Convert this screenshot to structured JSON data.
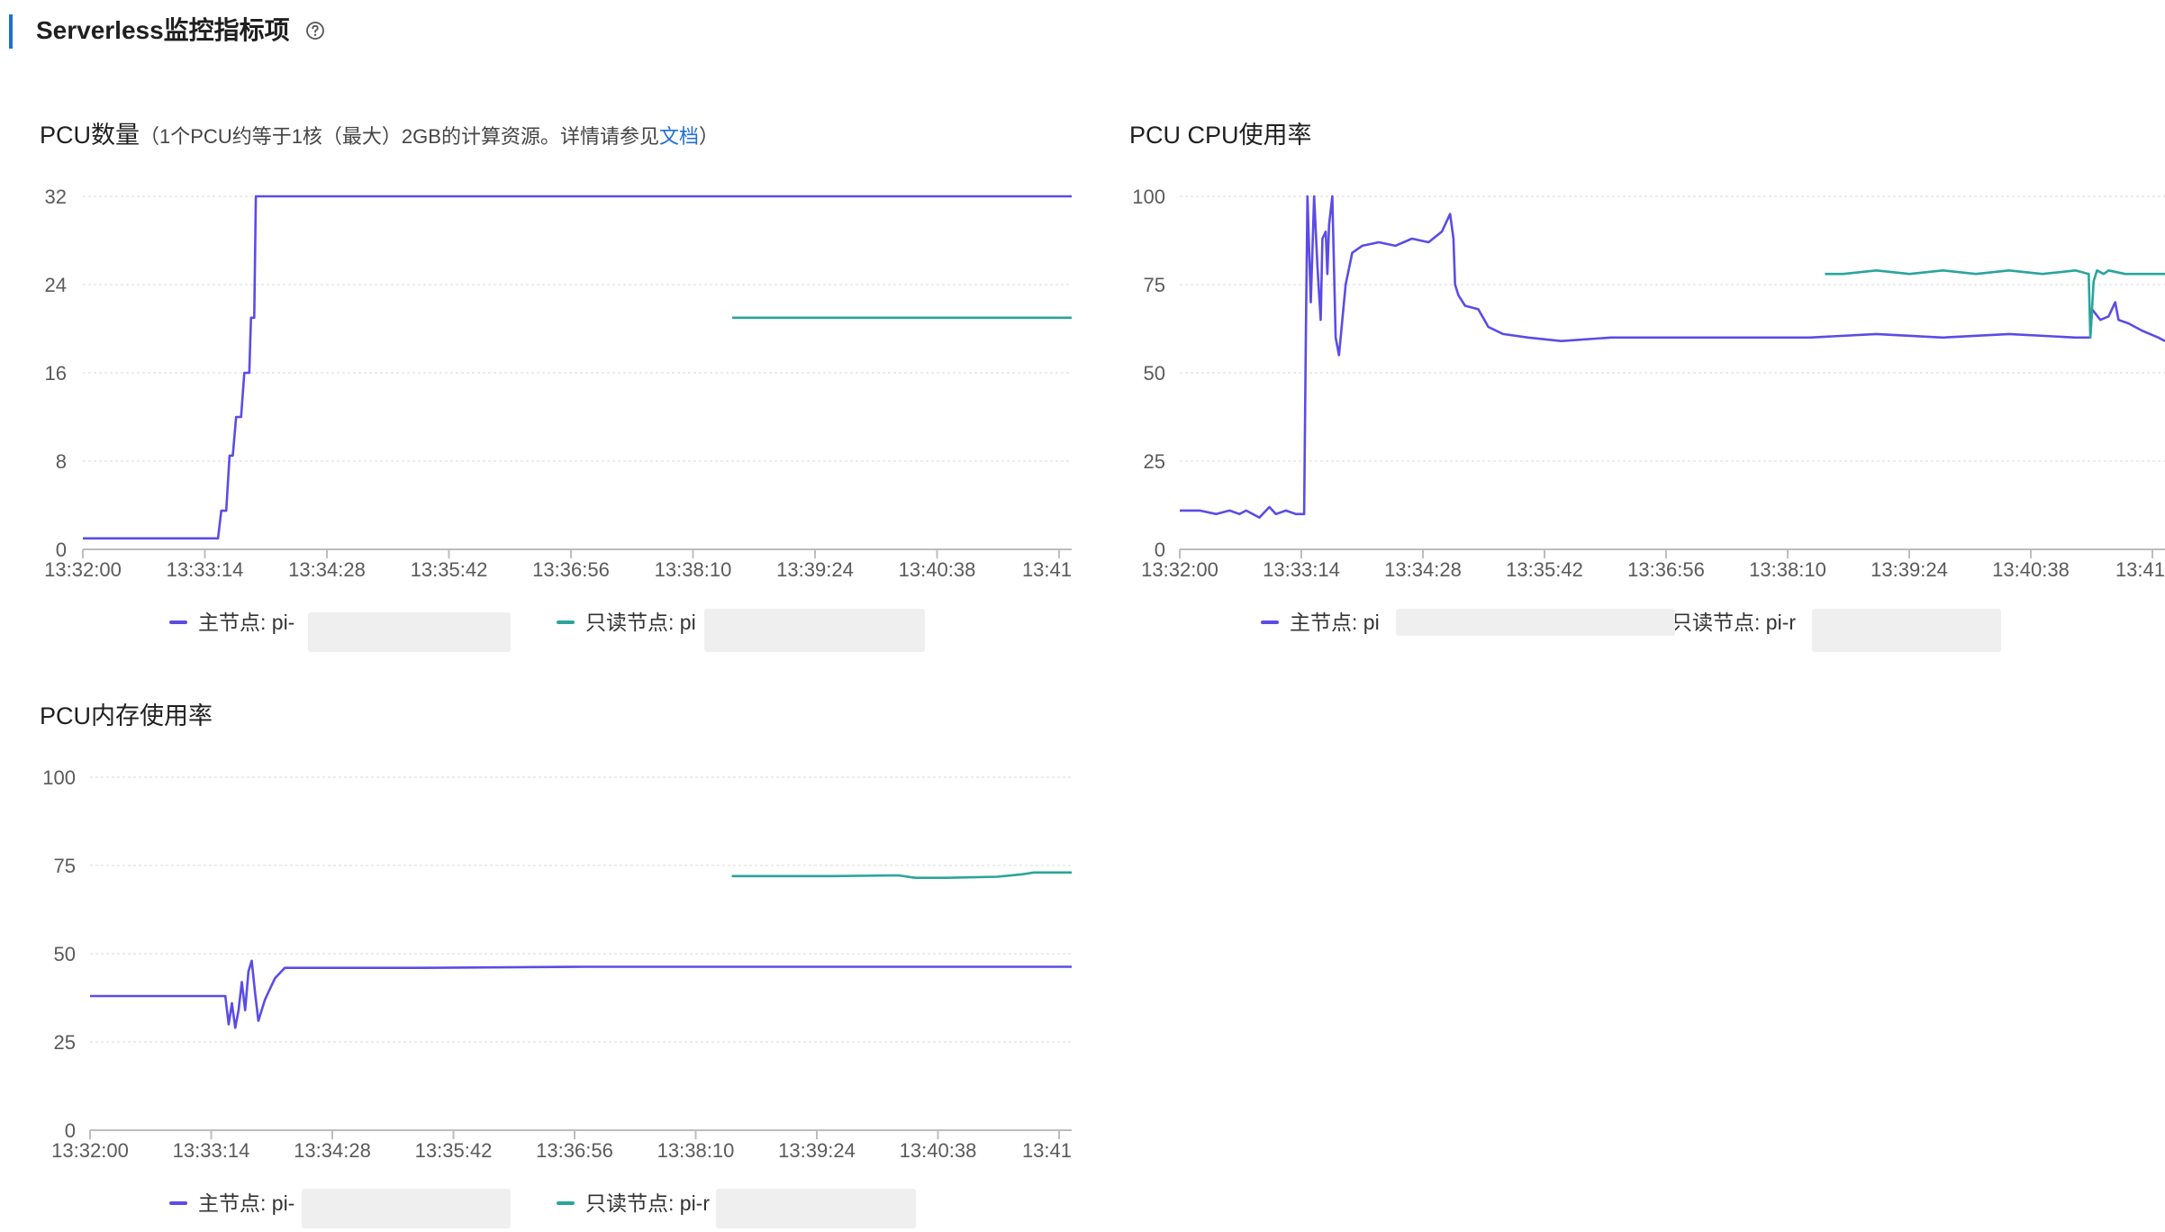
{
  "header": {
    "title": "Serverless监控指标项"
  },
  "colors": {
    "primary": "#5b4ce6",
    "readonly": "#2aa59b",
    "accent": "#1f6fd1",
    "grid": "#e6e6e6",
    "axis_text": "#5a5a5a"
  },
  "charts": [
    {
      "id": "pcu-count",
      "title": "PCU数量",
      "note_prefix": "（1个PCU约等于1核（最大）2GB的计算资源。详情请参见",
      "note_link": "文档",
      "note_suffix": "）",
      "legend": [
        {
          "label": "主节点: pi-"
        },
        {
          "label": "只读节点: pi"
        }
      ]
    },
    {
      "id": "pcu-cpu",
      "title": "PCU CPU使用率",
      "legend": [
        {
          "label": "主节点: pi"
        },
        {
          "label": "只读节点: pi-r"
        }
      ]
    },
    {
      "id": "pcu-mem",
      "title": "PCU内存使用率",
      "legend": [
        {
          "label": "主节点: pi-"
        },
        {
          "label": "只读节点: pi-r"
        }
      ]
    }
  ],
  "chart_data": [
    {
      "type": "line",
      "title": "PCU数量",
      "x_ticks": [
        "13:32:00",
        "13:33:14",
        "13:34:28",
        "13:35:42",
        "13:36:56",
        "13:38:10",
        "13:39:24",
        "13:40:38",
        "13:41"
      ],
      "x_range_seconds": [
        0,
        600
      ],
      "ylim": [
        0,
        32
      ],
      "y_ticks": [
        0,
        8,
        16,
        24,
        32
      ],
      "grid": true,
      "legend_position": "bottom",
      "series": [
        {
          "name": "主节点: pi-",
          "color": "#5b4ce6",
          "points": [
            [
              0,
              1
            ],
            [
              82,
              1
            ],
            [
              84,
              3.5
            ],
            [
              87,
              3.5
            ],
            [
              89,
              8.5
            ],
            [
              91,
              8.5
            ],
            [
              93,
              12
            ],
            [
              96,
              12
            ],
            [
              98,
              16
            ],
            [
              101,
              16
            ],
            [
              102,
              21
            ],
            [
              104,
              21
            ],
            [
              105,
              32
            ],
            [
              600,
              32
            ]
          ]
        },
        {
          "name": "只读节点: pi",
          "color": "#2aa59b",
          "points": [
            [
              394,
              21
            ],
            [
              600,
              21
            ]
          ]
        }
      ]
    },
    {
      "type": "line",
      "title": "PCU CPU使用率",
      "x_ticks": [
        "13:32:00",
        "13:33:14",
        "13:34:28",
        "13:35:42",
        "13:36:56",
        "13:38:10",
        "13:39:24",
        "13:40:38",
        "13:41"
      ],
      "x_range_seconds": [
        0,
        594
      ],
      "ylim": [
        0,
        100
      ],
      "y_ticks": [
        0,
        25,
        50,
        75,
        100
      ],
      "grid": true,
      "legend_position": "bottom",
      "series": [
        {
          "name": "主节点: pi",
          "color": "#5b4ce6",
          "points": [
            [
              0,
              11
            ],
            [
              12,
              11
            ],
            [
              22,
              10
            ],
            [
              30,
              11
            ],
            [
              36,
              10
            ],
            [
              40,
              11
            ],
            [
              48,
              9
            ],
            [
              54,
              12
            ],
            [
              58,
              10
            ],
            [
              64,
              11
            ],
            [
              70,
              10
            ],
            [
              75,
              10
            ],
            [
              76,
              60
            ],
            [
              77,
              100
            ],
            [
              79,
              70
            ],
            [
              81,
              100
            ],
            [
              83,
              80
            ],
            [
              85,
              65
            ],
            [
              86,
              88
            ],
            [
              88,
              90
            ],
            [
              89,
              78
            ],
            [
              90,
              92
            ],
            [
              92,
              100
            ],
            [
              94,
              60
            ],
            [
              96,
              55
            ],
            [
              100,
              75
            ],
            [
              104,
              84
            ],
            [
              110,
              86
            ],
            [
              120,
              87
            ],
            [
              130,
              86
            ],
            [
              140,
              88
            ],
            [
              150,
              87
            ],
            [
              158,
              90
            ],
            [
              163,
              95
            ],
            [
              165,
              88
            ],
            [
              166,
              75
            ],
            [
              168,
              72
            ],
            [
              172,
              69
            ],
            [
              180,
              68
            ],
            [
              186,
              63
            ],
            [
              195,
              61
            ],
            [
              210,
              60
            ],
            [
              230,
              59
            ],
            [
              260,
              60
            ],
            [
              300,
              60
            ],
            [
              340,
              60
            ],
            [
              380,
              60
            ],
            [
              420,
              61
            ],
            [
              460,
              60
            ],
            [
              500,
              61
            ],
            [
              540,
              60
            ],
            [
              549,
              60
            ],
            [
              550,
              68
            ],
            [
              555,
              65
            ],
            [
              560,
              66
            ],
            [
              564,
              70
            ],
            [
              566,
              65
            ],
            [
              572,
              64
            ],
            [
              580,
              62
            ],
            [
              585,
              61
            ],
            [
              590,
              60
            ],
            [
              594,
              59
            ]
          ]
        },
        {
          "name": "只读节点: pi-r",
          "color": "#2aa59b",
          "points": [
            [
              389,
              78
            ],
            [
              400,
              78
            ],
            [
              420,
              79
            ],
            [
              440,
              78
            ],
            [
              460,
              79
            ],
            [
              480,
              78
            ],
            [
              500,
              79
            ],
            [
              520,
              78
            ],
            [
              540,
              79
            ],
            [
              548,
              78
            ],
            [
              549,
              60
            ],
            [
              551,
              76
            ],
            [
              553,
              79
            ],
            [
              557,
              78
            ],
            [
              560,
              79
            ],
            [
              570,
              78
            ],
            [
              580,
              78
            ],
            [
              594,
              78
            ]
          ]
        }
      ]
    },
    {
      "type": "line",
      "title": "PCU内存使用率",
      "x_ticks": [
        "13:32:00",
        "13:33:14",
        "13:34:28",
        "13:35:42",
        "13:36:56",
        "13:38:10",
        "13:39:24",
        "13:40:38",
        "13:41"
      ],
      "x_range_seconds": [
        0,
        595
      ],
      "ylim": [
        0,
        100
      ],
      "y_ticks": [
        0,
        25,
        50,
        75,
        100
      ],
      "grid": true,
      "legend_position": "bottom",
      "series": [
        {
          "name": "主节点: pi-",
          "color": "#5b4ce6",
          "points": [
            [
              0,
              38
            ],
            [
              82,
              38
            ],
            [
              84,
              30
            ],
            [
              86,
              36
            ],
            [
              88,
              29
            ],
            [
              90,
              34
            ],
            [
              92,
              42
            ],
            [
              94,
              34
            ],
            [
              96,
              45
            ],
            [
              98,
              48
            ],
            [
              100,
              39
            ],
            [
              102,
              31
            ],
            [
              106,
              37
            ],
            [
              112,
              43
            ],
            [
              118,
              46
            ],
            [
              130,
              46
            ],
            [
              200,
              46
            ],
            [
              300,
              46.3
            ],
            [
              400,
              46.3
            ],
            [
              500,
              46.3
            ],
            [
              595,
              46.3
            ]
          ]
        },
        {
          "name": "只读节点: pi-r",
          "color": "#2aa59b",
          "points": [
            [
              389,
              72
            ],
            [
              450,
              72
            ],
            [
              490,
              72.2
            ],
            [
              500,
              71.5
            ],
            [
              520,
              71.5
            ],
            [
              550,
              71.8
            ],
            [
              565,
              72.5
            ],
            [
              572,
              73
            ],
            [
              580,
              73
            ],
            [
              595,
              73
            ]
          ]
        }
      ]
    }
  ]
}
